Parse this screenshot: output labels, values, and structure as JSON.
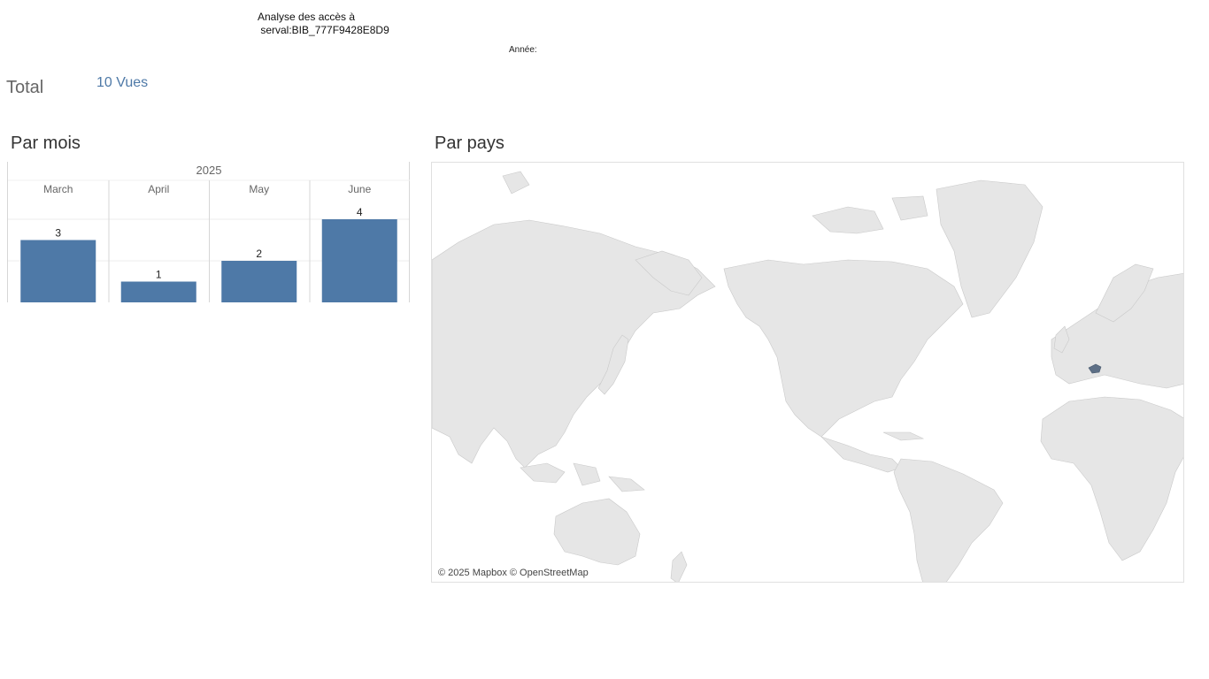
{
  "header": {
    "title": "Analyse des accès à\n serval:BIB_777F9428E8D9",
    "year_filter_label": "Année:"
  },
  "summary": {
    "total_label": "Total",
    "total_value": "10 Vues"
  },
  "sections": {
    "by_month": "Par mois",
    "by_country": "Par pays"
  },
  "chart_data": {
    "type": "bar",
    "year_label": "2025",
    "categories": [
      "March",
      "April",
      "May",
      "June"
    ],
    "values": [
      3,
      1,
      2,
      4
    ],
    "ylim": [
      0,
      4
    ],
    "bar_color": "#4e79a7"
  },
  "map": {
    "attribution": "© 2025 Mapbox © OpenStreetMap",
    "highlighted_country": "Switzerland",
    "highlight_color": "#5d6f86"
  }
}
